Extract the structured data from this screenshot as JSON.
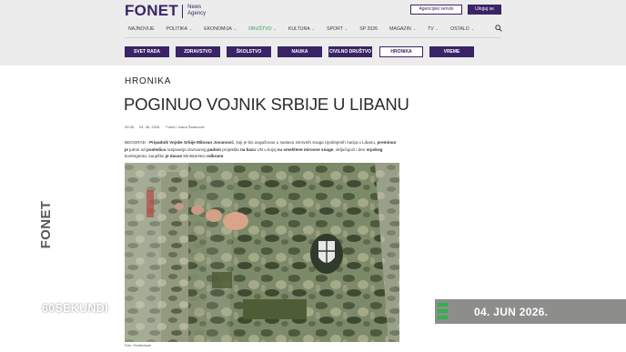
{
  "header": {
    "logo_word": "FONET",
    "logo_sub": "News Agency",
    "agency_button": "Agencijski servisi",
    "login_button": "Uloguj se",
    "nav": [
      {
        "label": "NAJNOVIJE",
        "dropdown": false,
        "active": false
      },
      {
        "label": "POLITIKA",
        "dropdown": true,
        "active": false
      },
      {
        "label": "EKONOMIJA",
        "dropdown": true,
        "active": false
      },
      {
        "label": "DRUŠTVO",
        "dropdown": true,
        "active": true
      },
      {
        "label": "KULTURA",
        "dropdown": true,
        "active": false
      },
      {
        "label": "SPORT",
        "dropdown": true,
        "active": false
      },
      {
        "label": "SP 2026",
        "dropdown": false,
        "active": false
      },
      {
        "label": "MAGAZIN",
        "dropdown": true,
        "active": false
      },
      {
        "label": "TV",
        "dropdown": true,
        "active": false
      },
      {
        "label": "OSTALO",
        "dropdown": true,
        "active": false
      }
    ],
    "sub_tabs": [
      {
        "label": "SVET RADA",
        "active": false
      },
      {
        "label": "ZDRAVSTVO",
        "active": false
      },
      {
        "label": "ŠKOLSTVO",
        "active": false
      },
      {
        "label": "NAUKA",
        "active": false
      },
      {
        "label": "CIVILNO DRUŠTVO",
        "active": false
      },
      {
        "label": "HRONIKA",
        "active": true
      },
      {
        "label": "VREME",
        "active": false
      }
    ],
    "icons": {
      "search": "search-icon"
    }
  },
  "article": {
    "category": "HRONIKA",
    "title": "POGINUO VOJNIK SRBIJE U LIBANU",
    "time": "09:38",
    "date": "04. 06. 2026.",
    "author": "Fonet / Ivana Šaranović",
    "lead_parts": [
      {
        "text": "BEOGRAD - ",
        "bold": false
      },
      {
        "text": "Pripadnik Vojske Srbije Milovan Jovanović",
        "bold": true
      },
      {
        "text": ", koji je bio angažovan u sastavu mirovnih snaga Ujedinjenih nacija u Libanu, ",
        "bold": false
      },
      {
        "text": "preminuo je",
        "bold": true
      },
      {
        "text": " jutros od ",
        "bold": false
      },
      {
        "text": "posledica",
        "bold": true
      },
      {
        "text": " ranjavanja izazvanog ",
        "bold": false
      },
      {
        "text": "padom",
        "bold": true
      },
      {
        "text": " projektila ",
        "bold": false
      },
      {
        "text": "na bazu",
        "bold": true
      },
      {
        "text": " UN u kojoj ",
        "bold": false
      },
      {
        "text": "su smeštene mirovne snage",
        "bold": true
      },
      {
        "text": ", uključujući i deo ",
        "bold": false
      },
      {
        "text": "srpskog",
        "bold": true
      },
      {
        "text": " kontingenta, saopštio ",
        "bold": false
      },
      {
        "text": "je danas",
        "bold": true
      },
      {
        "text": " Ministarstvo ",
        "bold": false
      },
      {
        "text": "odbrane",
        "bold": true
      },
      {
        "text": ".",
        "bold": false
      }
    ],
    "photo_caption": "Foto: Shutterstock"
  },
  "overlay": {
    "vertical_logo": "FONET",
    "brand": "60SEKUNDI",
    "date": "04. JUN 2026.",
    "colors": {
      "accent": "#2fb24a",
      "date_bar": "#8d8e8c",
      "brand_purple": "#3b2466",
      "nav_active": "#2e9d5b"
    }
  }
}
